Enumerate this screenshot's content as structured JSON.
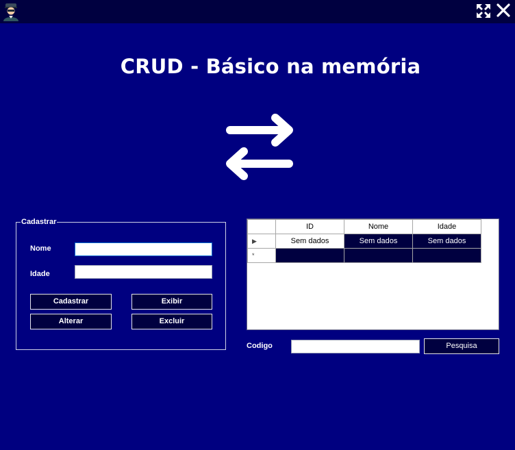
{
  "window": {
    "app_icon": "user-avatar-icon",
    "maximize_icon": "expand-arrows-icon",
    "close_icon": "close-icon"
  },
  "title": "CRUD - Básico na memória",
  "hero_icon": "swap-arrows-icon",
  "form": {
    "legend": "Cadastrar",
    "name_label": "Nome",
    "name_value": "",
    "age_label": "Idade",
    "age_value": "",
    "buttons": {
      "register": "Cadastrar",
      "show": "Exibir",
      "update": "Alterar",
      "delete": "Excluir"
    }
  },
  "grid": {
    "columns": [
      "ID",
      "Nome",
      "Idade"
    ],
    "rows": [
      [
        "Sem dados",
        "Sem dados",
        "Sem dados"
      ]
    ],
    "current_row_marker": "▶",
    "new_row_marker": "*"
  },
  "search": {
    "label": "Codigo",
    "value": "",
    "button": "Pesquisa"
  },
  "colors": {
    "background": "#000080",
    "titlebar": "#000040",
    "button": "#000040"
  }
}
